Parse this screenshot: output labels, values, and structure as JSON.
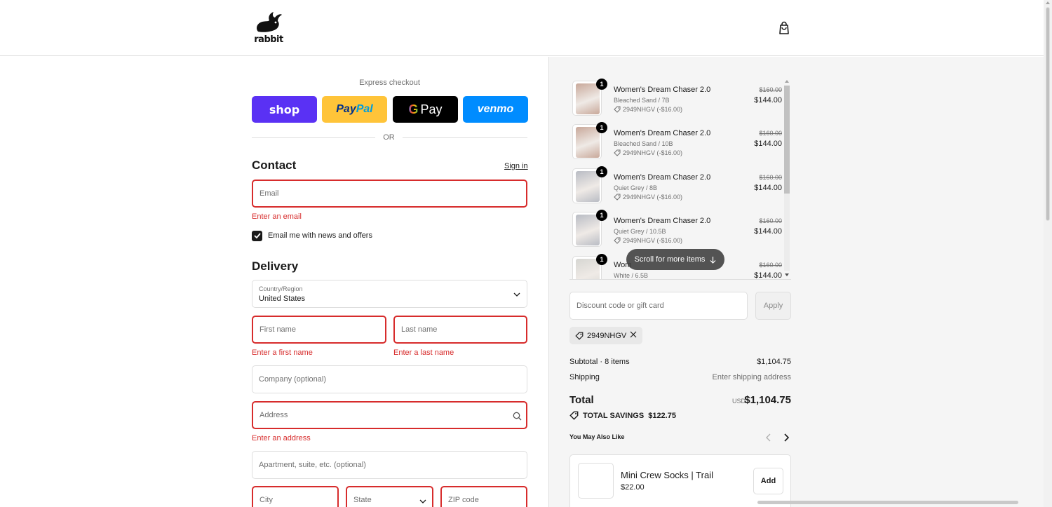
{
  "brand": {
    "logo_text": "rabbit"
  },
  "express": {
    "label": "Express checkout",
    "buttons": {
      "shop": "shop",
      "paypal_a": "Pay",
      "paypal_b": "Pal",
      "gpay_g": "G",
      "gpay": "Pay",
      "venmo": "venmo"
    },
    "or_text": "OR"
  },
  "contact": {
    "title": "Contact",
    "sign_in": "Sign in",
    "email_placeholder": "Email",
    "email_error": "Enter an email",
    "newsletter_label": "Email me with news and offers",
    "newsletter_checked": true
  },
  "delivery": {
    "title": "Delivery",
    "country_label": "Country/Region",
    "country_value": "United States",
    "first_name_placeholder": "First name",
    "first_name_error": "Enter a first name",
    "last_name_placeholder": "Last name",
    "last_name_error": "Enter a last name",
    "company_placeholder": "Company (optional)",
    "address_placeholder": "Address",
    "address_error": "Enter an address",
    "apartment_placeholder": "Apartment, suite, etc. (optional)",
    "city_placeholder": "City",
    "state_placeholder": "State",
    "zip_placeholder": "ZIP code"
  },
  "cart": {
    "items": [
      {
        "qty": "1",
        "name": "Women's Dream Chaser 2.0",
        "variant": "Bleached Sand / 7B",
        "code": "2949NHGV (-$16.00)",
        "old_price": "$160.00",
        "price": "$144.00",
        "color": "#c8a89a"
      },
      {
        "qty": "1",
        "name": "Women's Dream Chaser 2.0",
        "variant": "Bleached Sand / 10B",
        "code": "2949NHGV (-$16.00)",
        "old_price": "$160.00",
        "price": "$144.00",
        "color": "#c8a89a"
      },
      {
        "qty": "1",
        "name": "Women's Dream Chaser 2.0",
        "variant": "Quiet Grey / 8B",
        "code": "2949NHGV (-$16.00)",
        "old_price": "$160.00",
        "price": "$144.00",
        "color": "#b9bcc4"
      },
      {
        "qty": "1",
        "name": "Women's Dream Chaser 2.0",
        "variant": "Quiet Grey / 10.5B",
        "code": "2949NHGV (-$16.00)",
        "old_price": "$160.00",
        "price": "$144.00",
        "color": "#b9bcc4"
      },
      {
        "qty": "1",
        "name": "Wom",
        "variant": "White / 6.5B",
        "code": "",
        "old_price": "$160.00",
        "price": "$144.00",
        "color": "#d6d6d2"
      }
    ],
    "scroll_hint": "Scroll for more items",
    "discount_placeholder": "Discount code or gift card",
    "apply_label": "Apply",
    "applied_code": "2949NHGV",
    "subtotal_label": "Subtotal · 8 items",
    "subtotal_value": "$1,104.75",
    "shipping_label": "Shipping",
    "shipping_value": "Enter shipping address",
    "total_label": "Total",
    "total_currency": "USD",
    "total_value": "$1,104.75",
    "savings_label": "TOTAL SAVINGS",
    "savings_value": "$122.75"
  },
  "recommendations": {
    "title": "You May Also Like",
    "product_name": "Mini Crew Socks | Trail",
    "product_price": "$22.00",
    "add_label": "Add"
  },
  "colors": {
    "error": "#d72c2c",
    "shop": "#5a31f4",
    "paypal": "#ffc439",
    "venmo": "#008cff"
  }
}
